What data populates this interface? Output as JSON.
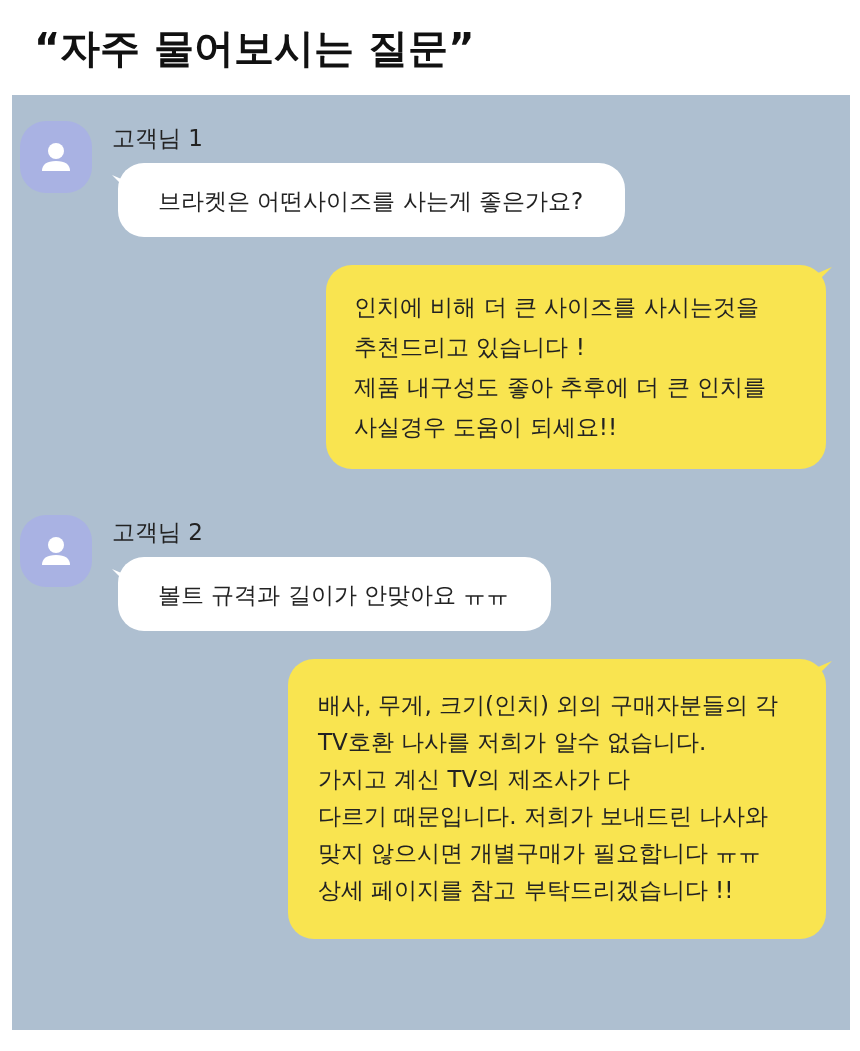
{
  "title": "“자주 물어보시는 질문”",
  "messages": [
    {
      "kind": "received",
      "sender": "고객님 1",
      "lines": [
        "브라켓은 어떤사이즈를 사는게 좋은가요?"
      ]
    },
    {
      "kind": "sent",
      "lines": [
        "인치에 비해 더 큰 사이즈를 사시는것을",
        "추천드리고 있습니다 !",
        "제품 내구성도 좋아 추후에 더 큰 인치를",
        "사실경우 도움이 되세요!!"
      ]
    },
    {
      "kind": "received",
      "sender": "고객님 2",
      "lines": [
        "볼트 규격과 길이가 안맞아요 ㅠㅠ"
      ]
    },
    {
      "kind": "sent",
      "lines": [
        "배사, 무게, 크기(인치) 외의 구매자분들의 각",
        "TV호환 나사를 저희가 알수 없습니다.",
        "가지고 계신 TV의 제조사가 다",
        "다르기 때문입니다. 저희가 보내드린 나사와",
        "맞지 않으시면 개별구매가 필요합니다 ㅠㅠ",
        "상세 페이지를 참고 부탁드리겠습니다 !!"
      ]
    }
  ]
}
